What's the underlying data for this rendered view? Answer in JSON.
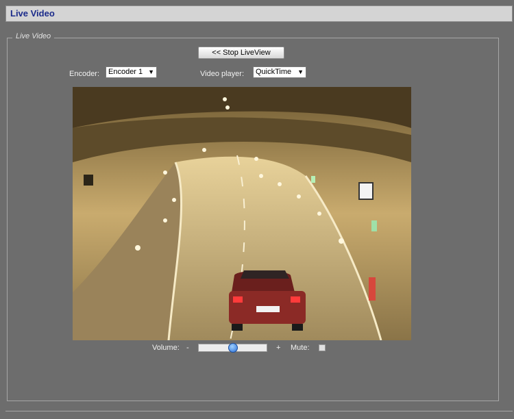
{
  "header": {
    "title": "Live Video"
  },
  "panel": {
    "legend": "Live Video"
  },
  "controls": {
    "stop_button_label": "<< Stop LiveView",
    "encoder_label": "Encoder:",
    "encoder_value": "Encoder 1",
    "player_label": "Video player:",
    "player_value": "QuickTime"
  },
  "audio": {
    "volume_label": "Volume:",
    "volume_minus": "-",
    "volume_plus": "+",
    "volume_level": 0.5,
    "mute_label": "Mute:",
    "mute_checked": false
  },
  "colors": {
    "title_text": "#1a2a8a",
    "background": "#6d6d6d",
    "volume_knob": "#2a70d8"
  },
  "icons": {
    "dropdown": "triangle-down-icon"
  }
}
